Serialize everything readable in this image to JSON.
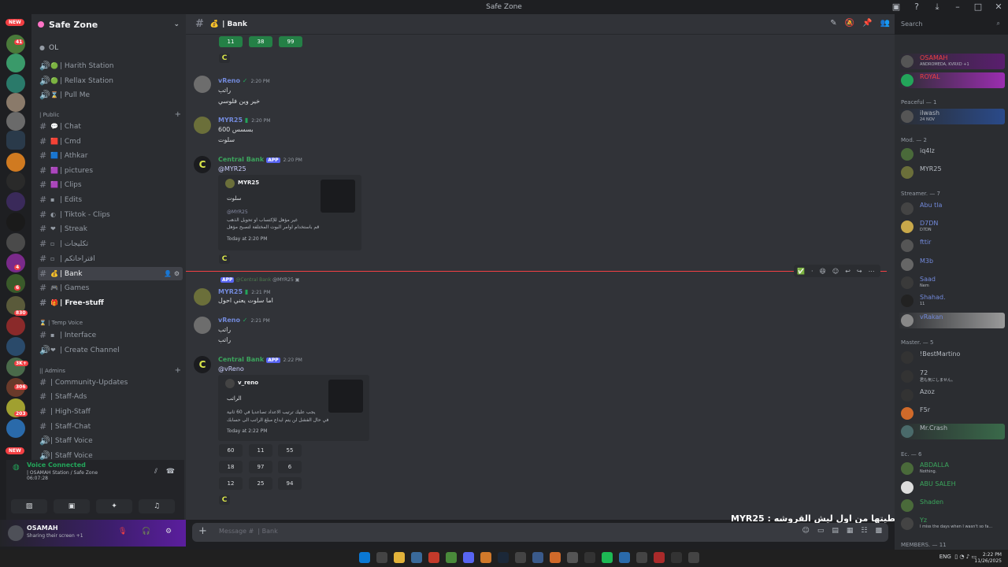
{
  "window": {
    "title": "Safe Zone"
  },
  "guild": {
    "name": "Safe Zone"
  },
  "rail": {
    "new_top": "NEW",
    "new_bottom": "NEW",
    "badges": [
      "41",
      "4",
      "6",
      "830",
      "3K+",
      "306",
      "203"
    ]
  },
  "channels": {
    "top_voice_user": "OL",
    "voice": [
      {
        "label": "| Harith Station"
      },
      {
        "label": "| Rellax Station"
      },
      {
        "label": "| Pull Me"
      }
    ],
    "public_category": "| Public",
    "public": [
      {
        "label": "| Chat"
      },
      {
        "label": "| Cmd"
      },
      {
        "label": "| Athkar"
      },
      {
        "label": "| pictures"
      },
      {
        "label": "| Clips"
      },
      {
        "label": "| Edits"
      },
      {
        "label": "| Tiktok - Clips"
      },
      {
        "label": "| Streak"
      },
      {
        "label": "| تكليجات"
      },
      {
        "label": "| اقتراحاتكم"
      },
      {
        "label": "| Bank"
      },
      {
        "label": "| Games"
      },
      {
        "label": "| Free-stuff"
      }
    ],
    "temp_category": "| Temp Voice",
    "temp": [
      {
        "label": "| Interface"
      },
      {
        "label": "| Create Channel"
      }
    ],
    "admins_category": "|| Admins",
    "admins": [
      {
        "label": "| Community-Updates"
      },
      {
        "label": "| Staff-Ads"
      },
      {
        "label": "| High-Staff"
      },
      {
        "label": "| Staff-Chat"
      },
      {
        "label": "| Staff Voice"
      },
      {
        "label": "| Staff Voice"
      }
    ]
  },
  "voice_panel": {
    "title": "Voice Connected",
    "sub": "| OSAMAH Station / Safe Zone",
    "time": "06:07:28"
  },
  "user": {
    "name": "OSAMAH",
    "status": "Sharing their screen +1"
  },
  "header": {
    "channel": "| Bank"
  },
  "search": {
    "placeholder": "Search"
  },
  "messages": {
    "top_buttons": [
      "11",
      "38",
      "99"
    ],
    "m1": {
      "author": "vReno",
      "time": "2:20 PM",
      "lines": [
        "راتب",
        "خير وين فلوسي"
      ]
    },
    "m2": {
      "author": "MYR25",
      "time": "2:20 PM",
      "lines": [
        "بسسس 600",
        "سلوت"
      ]
    },
    "m3": {
      "author": "Central Bank",
      "app": "APP",
      "time": "2:20 PM",
      "mention": "@MYR25",
      "embed_author": "MYR25",
      "embed_title": "سلوت",
      "embed_mention": "@MYR25",
      "embed_desc1": "غير مؤهل للإكتساب او تحويل الذهب",
      "embed_desc2": "قم باستخدام اوامر البوت المختلفة لتصبح مؤهل",
      "embed_footer": "Today at 2:20 PM"
    },
    "reply_bar": {
      "app": "APP",
      "bot": "@Central Bank",
      "mention": "@MYR25"
    },
    "m4": {
      "author": "MYR25",
      "time": "2:21 PM",
      "lines": [
        "اما سلوت يعني احول"
      ]
    },
    "m5": {
      "author": "vReno",
      "time": "2:21 PM",
      "lines": [
        "راتب",
        "راتب"
      ]
    },
    "m6": {
      "author": "Central Bank",
      "app": "APP",
      "time": "2:22 PM",
      "mention": "@vReno",
      "embed_author": "v_reno",
      "embed_title": "الراتب",
      "embed_desc1": "يجب عليك ترتيب الاعداد تصاعديا في 60 ثانية",
      "embed_desc2": "في حال الفشل لن يتم ايداع مبلغ الراتب الى حسابك",
      "embed_footer": "Today at 2:22 PM"
    },
    "grid": [
      "60",
      "11",
      "55",
      "18",
      "97",
      "6",
      "12",
      "25",
      "94"
    ]
  },
  "composer": {
    "placeholder": "Message #  | Bank"
  },
  "overlay": {
    "text": "MYR25 : كنت اعطيتها من اول ليش القروشه"
  },
  "member_groups": {
    "peaceful": "Peaceful — 1",
    "mod": "Mod. — 2",
    "streamer": "Streamer. — 7",
    "master": "Master. — 5",
    "ec": "Ec. — 6",
    "members": "MEMBERS. — 11"
  },
  "members_top": [
    {
      "name": "OSAMAH",
      "status": "ANDROMEDA, KVRXD +1"
    },
    {
      "name": "ROYAL",
      "status": ""
    }
  ],
  "members_peaceful": [
    {
      "name": "ilwash",
      "status": "24 NOV"
    }
  ],
  "members_mod": [
    {
      "name": "iq4lz",
      "status": ""
    },
    {
      "name": "MYR25",
      "status": ""
    }
  ],
  "members_streamer": [
    {
      "name": "Abu tla",
      "status": ""
    },
    {
      "name": "D7DN",
      "status": "D7DN"
    },
    {
      "name": "fttir",
      "status": ""
    },
    {
      "name": "M3b",
      "status": ""
    },
    {
      "name": "Saad",
      "status": "Nem"
    },
    {
      "name": "Shahad.",
      "status": "11"
    },
    {
      "name": "vRakan",
      "status": ""
    }
  ],
  "members_master": [
    {
      "name": "!BestMartino",
      "status": ""
    },
    {
      "name": "72",
      "status": "君も気にしません。"
    },
    {
      "name": "Azoz",
      "status": ""
    },
    {
      "name": "F5r",
      "status": ""
    },
    {
      "name": "Mr.Crash",
      "status": ""
    }
  ],
  "members_ec": [
    {
      "name": "ABDALLA",
      "status": "Nothing."
    },
    {
      "name": "ABU SALEH",
      "status": ""
    },
    {
      "name": "Shaden",
      "status": ""
    },
    {
      "name": "Yz",
      "status": "I miss the days when I wasn't so fa..."
    }
  ],
  "taskbar": {
    "lang": "ENG",
    "time": "2:22 PM",
    "date": "11/26/2025"
  }
}
